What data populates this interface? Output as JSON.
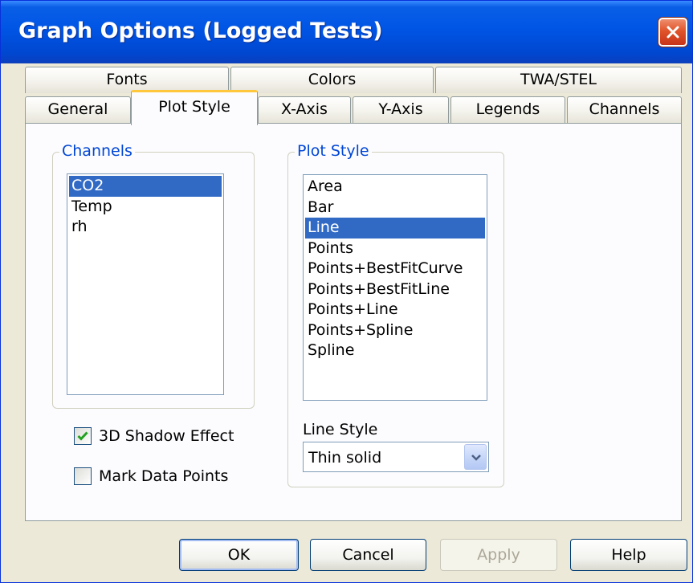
{
  "window": {
    "title": "Graph Options (Logged Tests)",
    "close_icon": "close-icon"
  },
  "tabs": {
    "row1": [
      {
        "label": "Fonts"
      },
      {
        "label": "Colors"
      },
      {
        "label": "TWA/STEL"
      }
    ],
    "row2": [
      {
        "label": "General"
      },
      {
        "label": "Plot Style",
        "active": true
      },
      {
        "label": "X-Axis"
      },
      {
        "label": "Y-Axis"
      },
      {
        "label": "Legends"
      },
      {
        "label": "Channels"
      }
    ]
  },
  "channels_group": {
    "label": "Channels",
    "items": [
      "CO2",
      "Temp",
      "rh"
    ],
    "selected": "CO2"
  },
  "plot_style_group": {
    "label": "Plot Style",
    "items": [
      "Area",
      "Bar",
      "Line",
      "Points",
      "Points+BestFitCurve",
      "Points+BestFitLine",
      "Points+Line",
      "Points+Spline",
      "Spline"
    ],
    "selected": "Line",
    "line_style_label": "Line Style",
    "line_style_value": "Thin solid"
  },
  "options": {
    "shadow_label": "3D Shadow Effect",
    "shadow_checked": true,
    "mark_points_label": "Mark Data Points",
    "mark_points_checked": false
  },
  "buttons": {
    "ok": "OK",
    "cancel": "Cancel",
    "apply": "Apply",
    "help": "Help"
  },
  "colors": {
    "title_bar": "#0055e5",
    "selection": "#316ac5",
    "group_label": "#0046d5",
    "active_tab_accent": "#ffc83c"
  }
}
